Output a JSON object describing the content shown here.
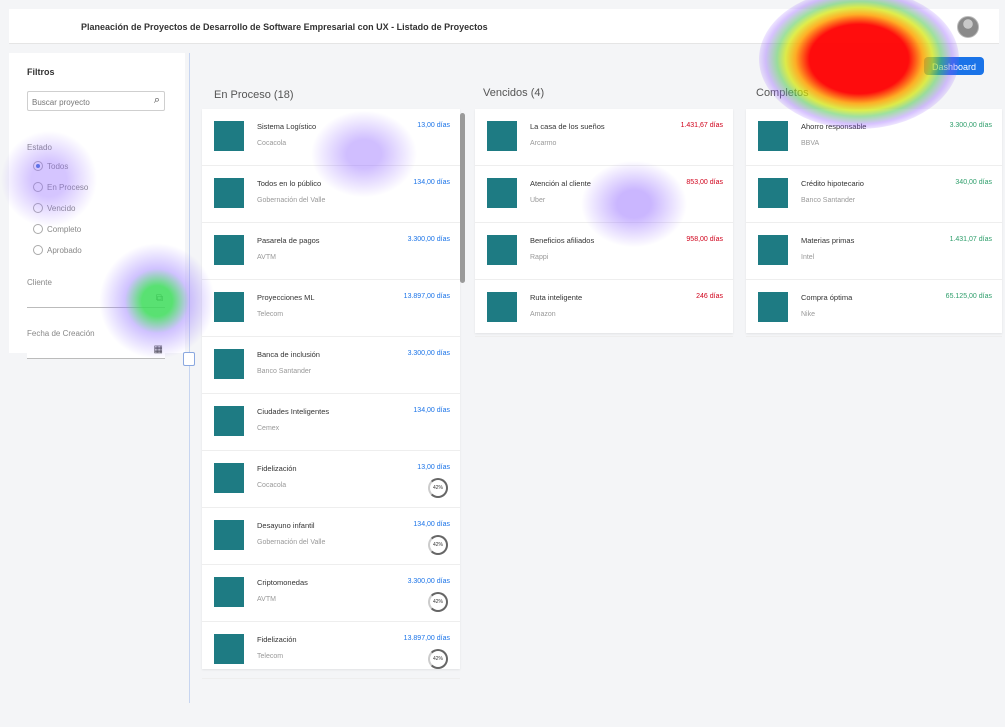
{
  "header": {
    "title": "Planeación de Proyectos de Desarrollo de Software Empresarial con UX - Listado de Proyectos",
    "dashboard_label": "Dashboard"
  },
  "filters": {
    "title": "Filtros",
    "search_placeholder": "Buscar proyecto",
    "state_label": "Estado",
    "states": [
      {
        "label": "Todos",
        "selected": true
      },
      {
        "label": "En Proceso",
        "selected": false
      },
      {
        "label": "Vencido",
        "selected": false
      },
      {
        "label": "Completo",
        "selected": false
      },
      {
        "label": "Aprobado",
        "selected": false
      }
    ],
    "client_label": "Cliente",
    "date_label": "Fecha de Creación"
  },
  "columns": [
    {
      "title": "En Proceso (18)",
      "cards": [
        {
          "name": "Sistema Logístico",
          "client": "Cocacola",
          "days": "13,00 días",
          "progress": ""
        },
        {
          "name": "Todos en lo público",
          "client": "Gobernación del Valle",
          "days": "134,00 días",
          "progress": ""
        },
        {
          "name": "Pasarela de pagos",
          "client": "AVTM",
          "days": "3.300,00 días",
          "progress": ""
        },
        {
          "name": "Proyecciones ML",
          "client": "Telecom",
          "days": "13.897,00 días",
          "progress": ""
        },
        {
          "name": "Banca de inclusión",
          "client": "Banco Santander",
          "days": "3.300,00 días",
          "progress": ""
        },
        {
          "name": "Ciudades Inteligentes",
          "client": "Cemex",
          "days": "134,00 días",
          "progress": ""
        },
        {
          "name": "Fidelización",
          "client": "Cocacola",
          "days": "13,00 días",
          "progress": "42%"
        },
        {
          "name": "Desayuno infantil",
          "client": "Gobernación del Valle",
          "days": "134,00 días",
          "progress": "42%"
        },
        {
          "name": "Criptomonedas",
          "client": "AVTM",
          "days": "3.300,00 días",
          "progress": "42%"
        },
        {
          "name": "Fidelización",
          "client": "Telecom",
          "days": "13.897,00 días",
          "progress": "42%"
        }
      ]
    },
    {
      "title": "Vencidos (4)",
      "cards": [
        {
          "name": "La casa de los sueños",
          "client": "Arcarmo",
          "days": "1.431,67 días"
        },
        {
          "name": "Atención al cliente",
          "client": "Uber",
          "days": "853,00 días"
        },
        {
          "name": "Beneficios afiliados",
          "client": "Rappi",
          "days": "958,00 días"
        },
        {
          "name": "Ruta inteligente",
          "client": "Amazon",
          "days": "246 días"
        }
      ]
    },
    {
      "title": "Completos",
      "cards": [
        {
          "name": "Ahorro responsable",
          "client": "BBVA",
          "days": "3.300,00 días"
        },
        {
          "name": "Crédito hipotecario",
          "client": "Banco Santander",
          "days": "340,00 días"
        },
        {
          "name": "Materias primas",
          "client": "Intel",
          "days": "1.431,07 días"
        },
        {
          "name": "Compra óptima",
          "client": "Nike",
          "days": "65.125,00 días"
        }
      ]
    }
  ],
  "colors": {
    "accent": "#1a73e8",
    "thumb": "#1e7b83",
    "overdue": "#d0021b",
    "complete": "#2e9e6b"
  }
}
